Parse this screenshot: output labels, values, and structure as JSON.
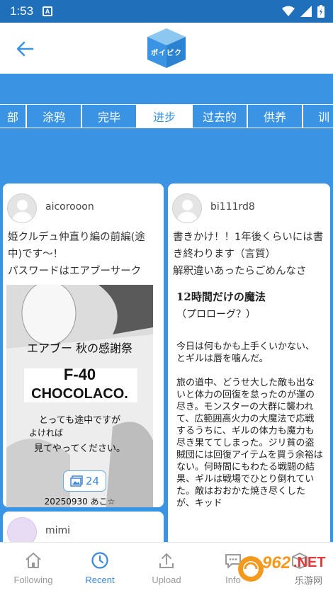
{
  "status": {
    "time": "1:53",
    "notif_label": "A"
  },
  "header": {
    "logo_text": "ポイピク"
  },
  "tabs": [
    "部",
    "涂鸦",
    "完毕",
    "进步",
    "过去的",
    "供养",
    "训"
  ],
  "active_tab": 3,
  "posts": [
    {
      "user": "aicorooon",
      "caption": "姫クルデュ仲直り編の前編(途中)です〜！\nパスワードはエアブーサーク",
      "image_lines": [
        "エアブー 秋の感謝祭",
        "F-40",
        "CHOCOLACO.",
        "とっても途中ですが",
        "よければ",
        "見てやってください。",
        "20250930 あこ☆"
      ],
      "image_count": "24"
    },
    {
      "user": "bi111rd8",
      "caption": "書きかけ！！1年後くらいには書き終わります（言質）\n解釈違いあったらごめんなさ",
      "story_title": "12時間だけの魔法",
      "story_subtitle": "（プロローグ？）",
      "story_paragraphs": [
        "今日は何もかも上手くいかない、とギルは唇を噛んだ。",
        "旅の道中、どうせ大した敵も出ないと体力の回復を怠ったのが運の尽き。モンスターの大群に襲われて、広範囲高火力の大魔法で応戦するうちに、ギルの体力も魔力も尽き果ててしまった。ジリ貧の盗賊団には回復アイテムを買う余裕はない。何時間にもわたる戦闘の結果、ギルは戦場でひとり倒れていた。敵はおおかた焼き尽くしたが、キッド"
      ]
    },
    {
      "user": "mimi"
    }
  ],
  "bottom_nav": [
    {
      "label": "Following",
      "icon": "home-icon"
    },
    {
      "label": "Recent",
      "icon": "clock-icon"
    },
    {
      "label": "Upload",
      "icon": "upload-icon"
    },
    {
      "label": "Info",
      "icon": "chat-icon"
    },
    {
      "label": "",
      "icon": "box-icon"
    }
  ],
  "active_nav": 1,
  "watermark": {
    "number": "962",
    "suffix": ".NET",
    "sub": "乐游网"
  },
  "colors": {
    "brand": "#3b94e3",
    "statusbar": "#1f6fba",
    "active": "#3b87d8"
  }
}
